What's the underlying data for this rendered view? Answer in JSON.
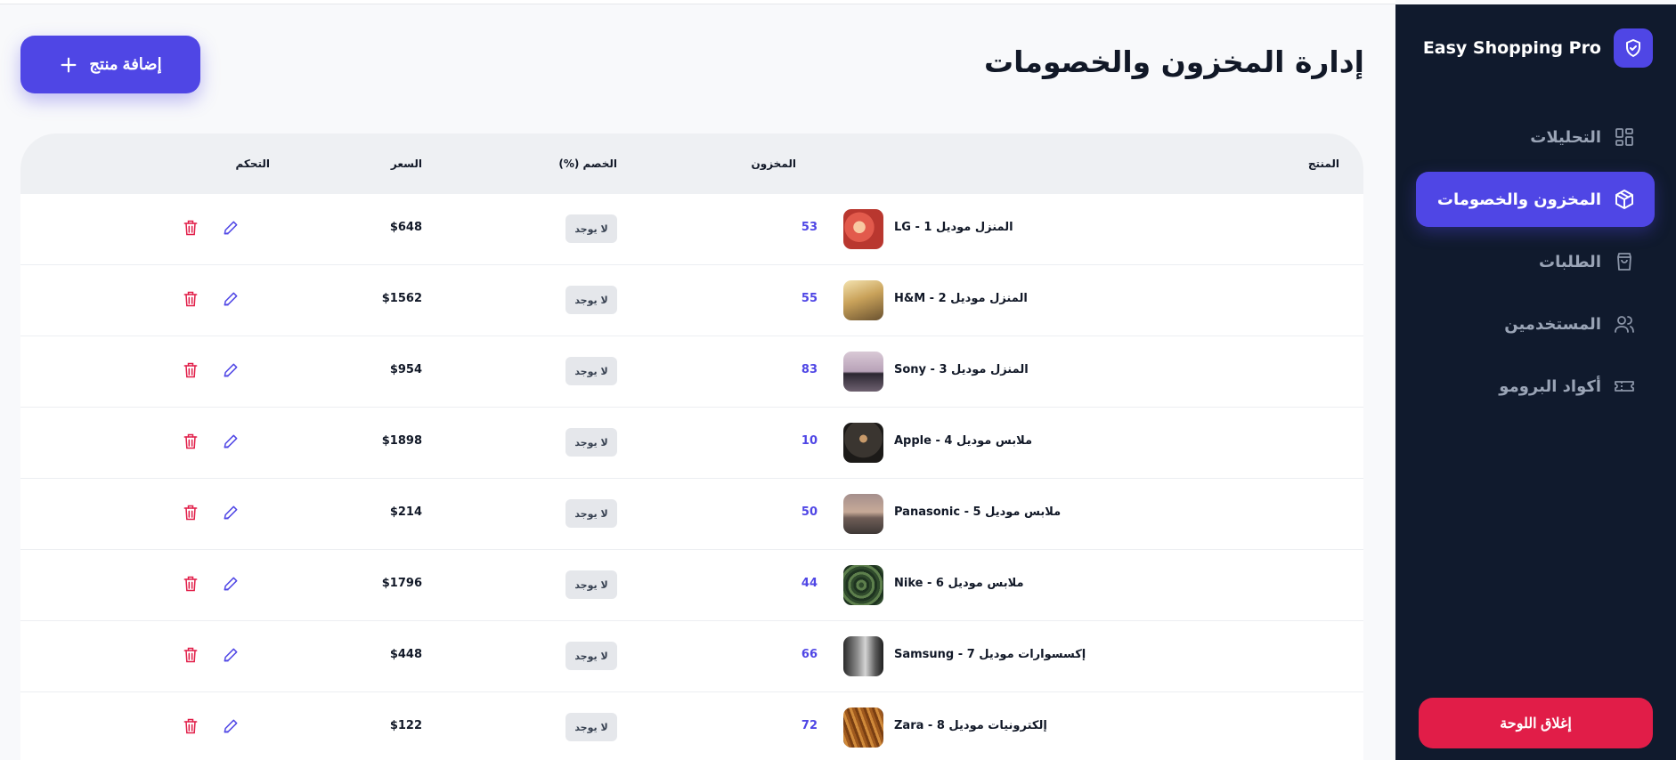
{
  "brand": {
    "name": "Easy Shopping Pro",
    "accent": "#4f46e5"
  },
  "nav": {
    "items": [
      {
        "label": "التحليلات",
        "icon": "grid-icon",
        "active": false
      },
      {
        "label": "المخزون والخصومات",
        "icon": "box-icon",
        "active": true
      },
      {
        "label": "الطلبات",
        "icon": "shopping-bag-icon",
        "active": false
      },
      {
        "label": "المستخدمين",
        "icon": "users-icon",
        "active": false
      },
      {
        "label": "أكواد البرومو",
        "icon": "ticket-icon",
        "active": false
      }
    ],
    "close_label": "إغلاق اللوحة"
  },
  "header": {
    "title": "إدارة المخزون والخصومات",
    "add_label": "إضافة منتج"
  },
  "table": {
    "columns": {
      "product": "المنتج",
      "stock": "المخزون",
      "discount": "الخصم (%)",
      "price": "السعر",
      "actions": "التحكم"
    },
    "rows": [
      {
        "name": "LG - المنزل موديل 1",
        "stock": "53",
        "discount": "لا يوجد",
        "price": "$648"
      },
      {
        "name": "H&M - المنزل موديل 2",
        "stock": "55",
        "discount": "لا يوجد",
        "price": "$1562"
      },
      {
        "name": "Sony - المنزل موديل 3",
        "stock": "83",
        "discount": "لا يوجد",
        "price": "$954"
      },
      {
        "name": "Apple - ملابس موديل 4",
        "stock": "10",
        "discount": "لا يوجد",
        "price": "$1898"
      },
      {
        "name": "Panasonic - ملابس موديل 5",
        "stock": "50",
        "discount": "لا يوجد",
        "price": "$214"
      },
      {
        "name": "Nike - ملابس موديل 6",
        "stock": "44",
        "discount": "لا يوجد",
        "price": "$1796"
      },
      {
        "name": "Samsung - إكسسوارات موديل 7",
        "stock": "66",
        "discount": "لا يوجد",
        "price": "$448"
      },
      {
        "name": "Zara - إلكترونيات موديل 8",
        "stock": "72",
        "discount": "لا يوجد",
        "price": "$122"
      }
    ]
  },
  "colors": {
    "sidebar": "#101a2d",
    "accent": "#4f46e5",
    "danger": "#e11d48"
  }
}
